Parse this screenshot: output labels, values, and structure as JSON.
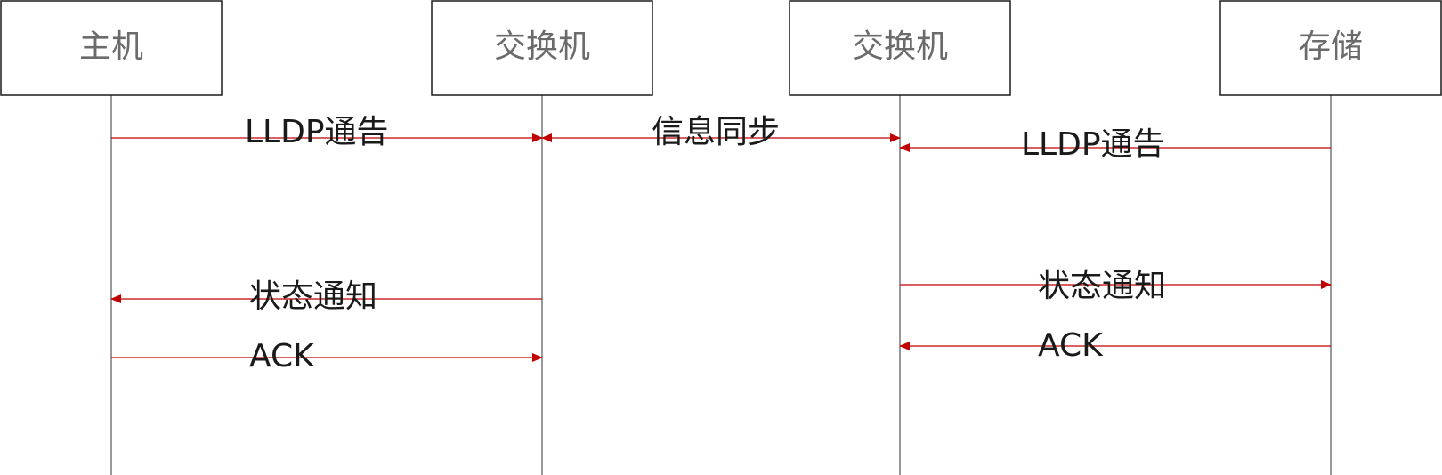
{
  "colors": {
    "arrow": "#c00000",
    "box_border": "#1a1a1a",
    "box_text": "#6b6b6b",
    "message_text": "#1a1a1a",
    "lifeline": "#333333"
  },
  "participants": [
    {
      "name": "主机"
    },
    {
      "name": "交换机"
    },
    {
      "name": "交换机"
    },
    {
      "name": "存储"
    }
  ],
  "messages": [
    {
      "label": "LLDP通告",
      "from": 0,
      "to": 1,
      "direction": "right"
    },
    {
      "label": "信息同步",
      "from": 1,
      "to": 2,
      "direction": "both"
    },
    {
      "label": "LLDP通告",
      "from": 3,
      "to": 2,
      "direction": "left"
    },
    {
      "label": "状态通知",
      "from": 1,
      "to": 0,
      "direction": "left"
    },
    {
      "label": "状态通知",
      "from": 2,
      "to": 3,
      "direction": "right"
    },
    {
      "label": "ACK",
      "from": 0,
      "to": 1,
      "direction": "right"
    },
    {
      "label": "ACK",
      "from": 3,
      "to": 2,
      "direction": "left"
    }
  ]
}
